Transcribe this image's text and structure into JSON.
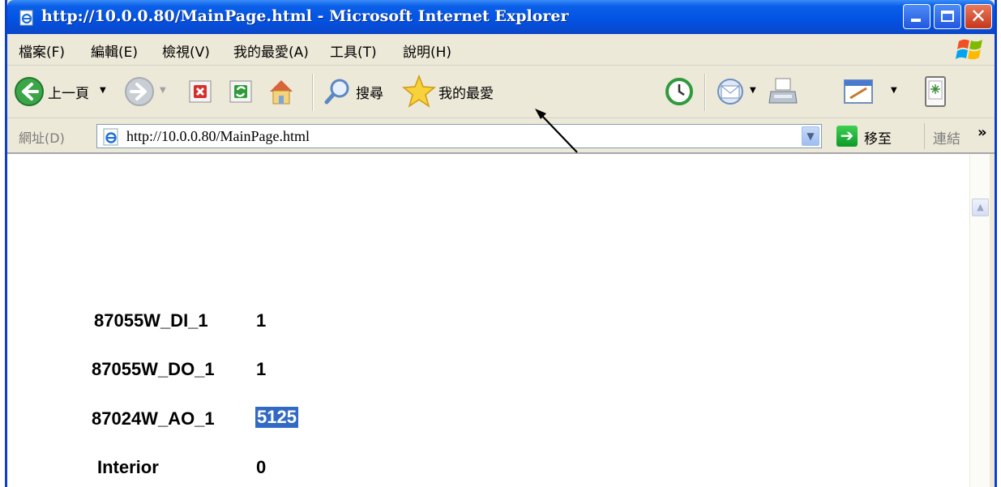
{
  "window": {
    "title": "http://10.0.0.80/MainPage.html - Microsoft Internet Explorer"
  },
  "menu": {
    "items": [
      "檔案(F)",
      "編輯(E)",
      "檢視(V)",
      "我的最愛(A)",
      "工具(T)",
      "說明(H)"
    ]
  },
  "toolbar": {
    "back_label": "上一頁",
    "search_label": "搜尋",
    "favorites_label": "我的最愛"
  },
  "address": {
    "label": "網址(D)",
    "url": "http://10.0.0.80/MainPage.html",
    "go_label": "移至",
    "links_label": "連結"
  },
  "page": {
    "rows": [
      {
        "label": "87055W_DI_1",
        "value": "1"
      },
      {
        "label": "87055W_DO_1",
        "value": "1"
      },
      {
        "label": "87024W_AO_1",
        "value": "5125"
      },
      {
        "label": "Interior",
        "value": "0"
      }
    ]
  },
  "colors": {
    "titlebar": "#0352e2",
    "highlight": "#316ac5",
    "annotation": "#c0282c"
  },
  "icons": {
    "back": "back-arrow-icon",
    "forward": "forward-arrow-icon",
    "stop": "stop-icon",
    "refresh": "refresh-icon",
    "home": "home-icon",
    "search": "search-icon",
    "favorites": "star-icon",
    "history": "history-icon",
    "mail": "mail-icon",
    "print": "print-icon",
    "edit": "edit-icon",
    "messenger": "messenger-icon"
  }
}
